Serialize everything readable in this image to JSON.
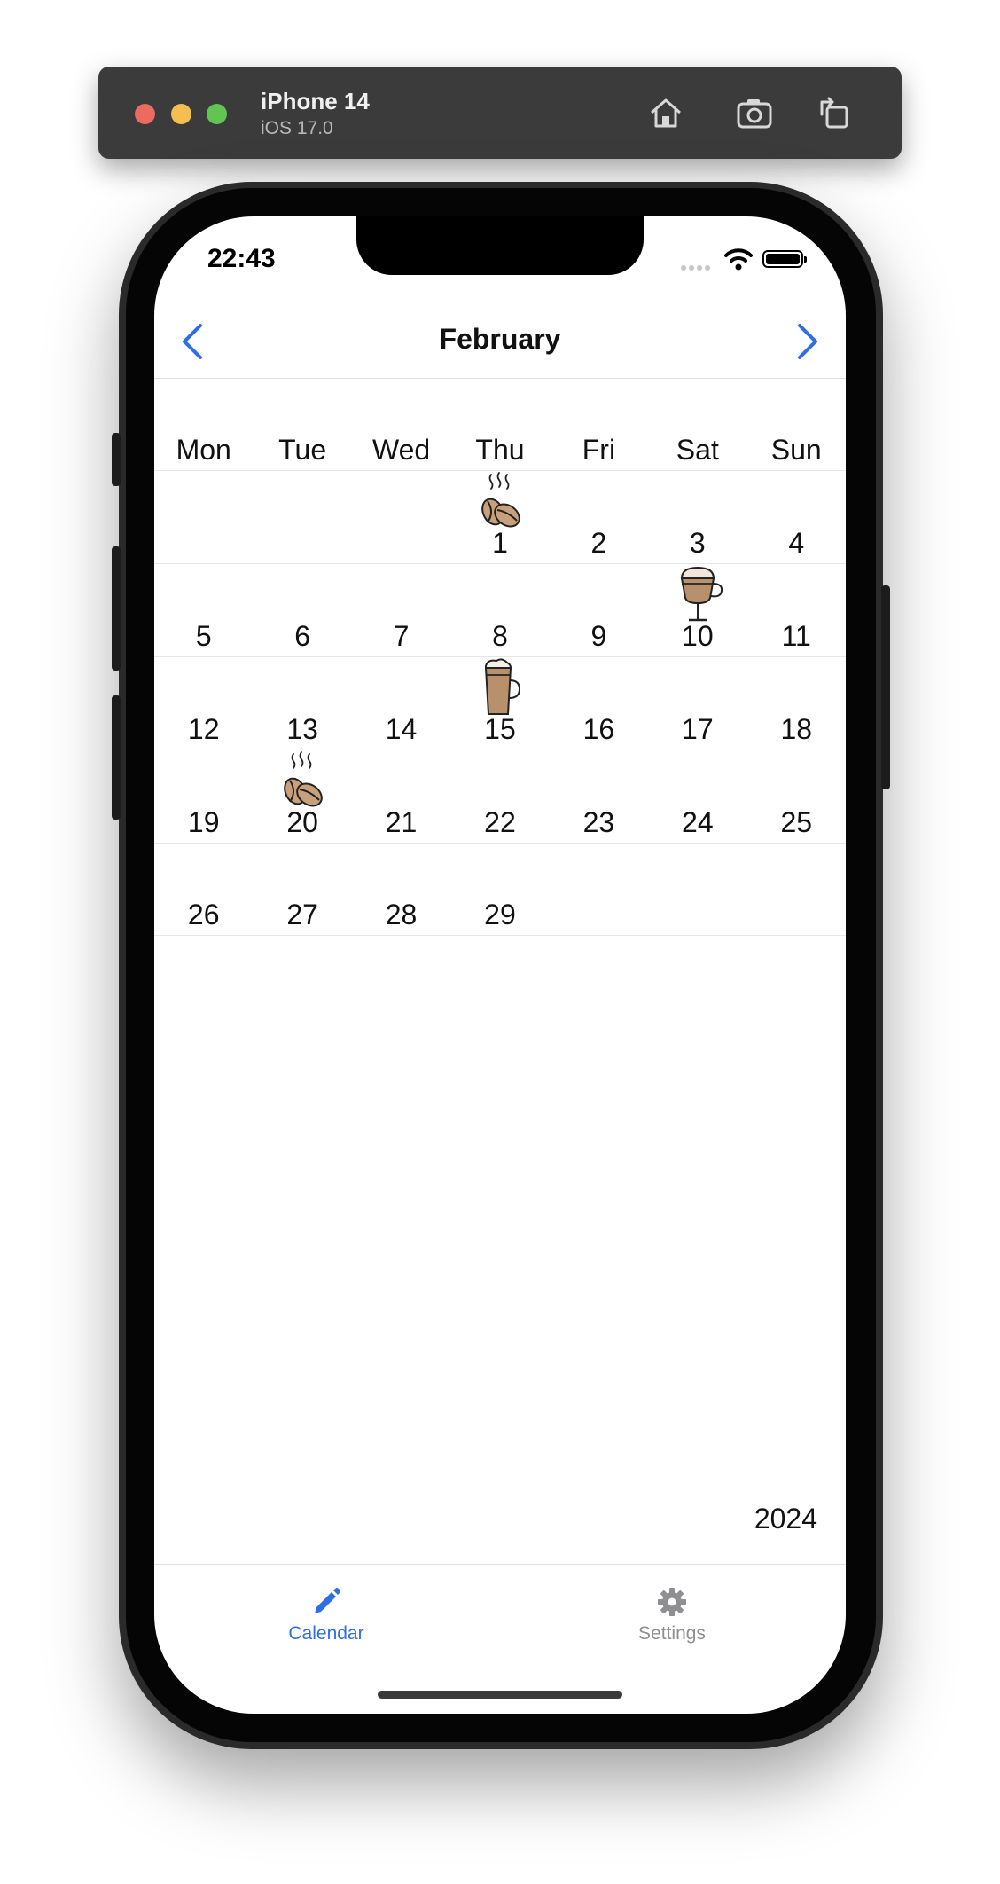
{
  "simulator": {
    "device": "iPhone 14",
    "os": "iOS 17.0",
    "icons": [
      "home-icon",
      "screenshot-icon",
      "rotate-icon"
    ]
  },
  "status_bar": {
    "time": "22:43"
  },
  "nav": {
    "title": "February",
    "prev_icon": "chevron-left-icon",
    "next_icon": "chevron-right-icon",
    "accent": "#2f6fe4"
  },
  "weekdays": [
    "Mon",
    "Tue",
    "Wed",
    "Thu",
    "Fri",
    "Sat",
    "Sun"
  ],
  "weeks": [
    [
      {
        "day": ""
      },
      {
        "day": ""
      },
      {
        "day": ""
      },
      {
        "day": "1",
        "icon": "coffee-beans-icon"
      },
      {
        "day": "2"
      },
      {
        "day": "3"
      },
      {
        "day": "4"
      }
    ],
    [
      {
        "day": "5"
      },
      {
        "day": "6"
      },
      {
        "day": "7"
      },
      {
        "day": "8"
      },
      {
        "day": "9"
      },
      {
        "day": "10",
        "icon": "irish-coffee-glass-icon"
      },
      {
        "day": "11"
      }
    ],
    [
      {
        "day": "12"
      },
      {
        "day": "13"
      },
      {
        "day": "14"
      },
      {
        "day": "15",
        "icon": "latte-glass-icon"
      },
      {
        "day": "16"
      },
      {
        "day": "17"
      },
      {
        "day": "18"
      }
    ],
    [
      {
        "day": "19"
      },
      {
        "day": "20",
        "icon": "coffee-beans-icon"
      },
      {
        "day": "21"
      },
      {
        "day": "22"
      },
      {
        "day": "23"
      },
      {
        "day": "24"
      },
      {
        "day": "25"
      }
    ],
    [
      {
        "day": "26"
      },
      {
        "day": "27"
      },
      {
        "day": "28"
      },
      {
        "day": "29"
      },
      {
        "day": ""
      },
      {
        "day": ""
      },
      {
        "day": ""
      }
    ]
  ],
  "year": "2024",
  "tabs": [
    {
      "label": "Calendar",
      "icon": "pencil-icon",
      "active": true
    },
    {
      "label": "Settings",
      "icon": "gear-icon",
      "active": false
    }
  ]
}
